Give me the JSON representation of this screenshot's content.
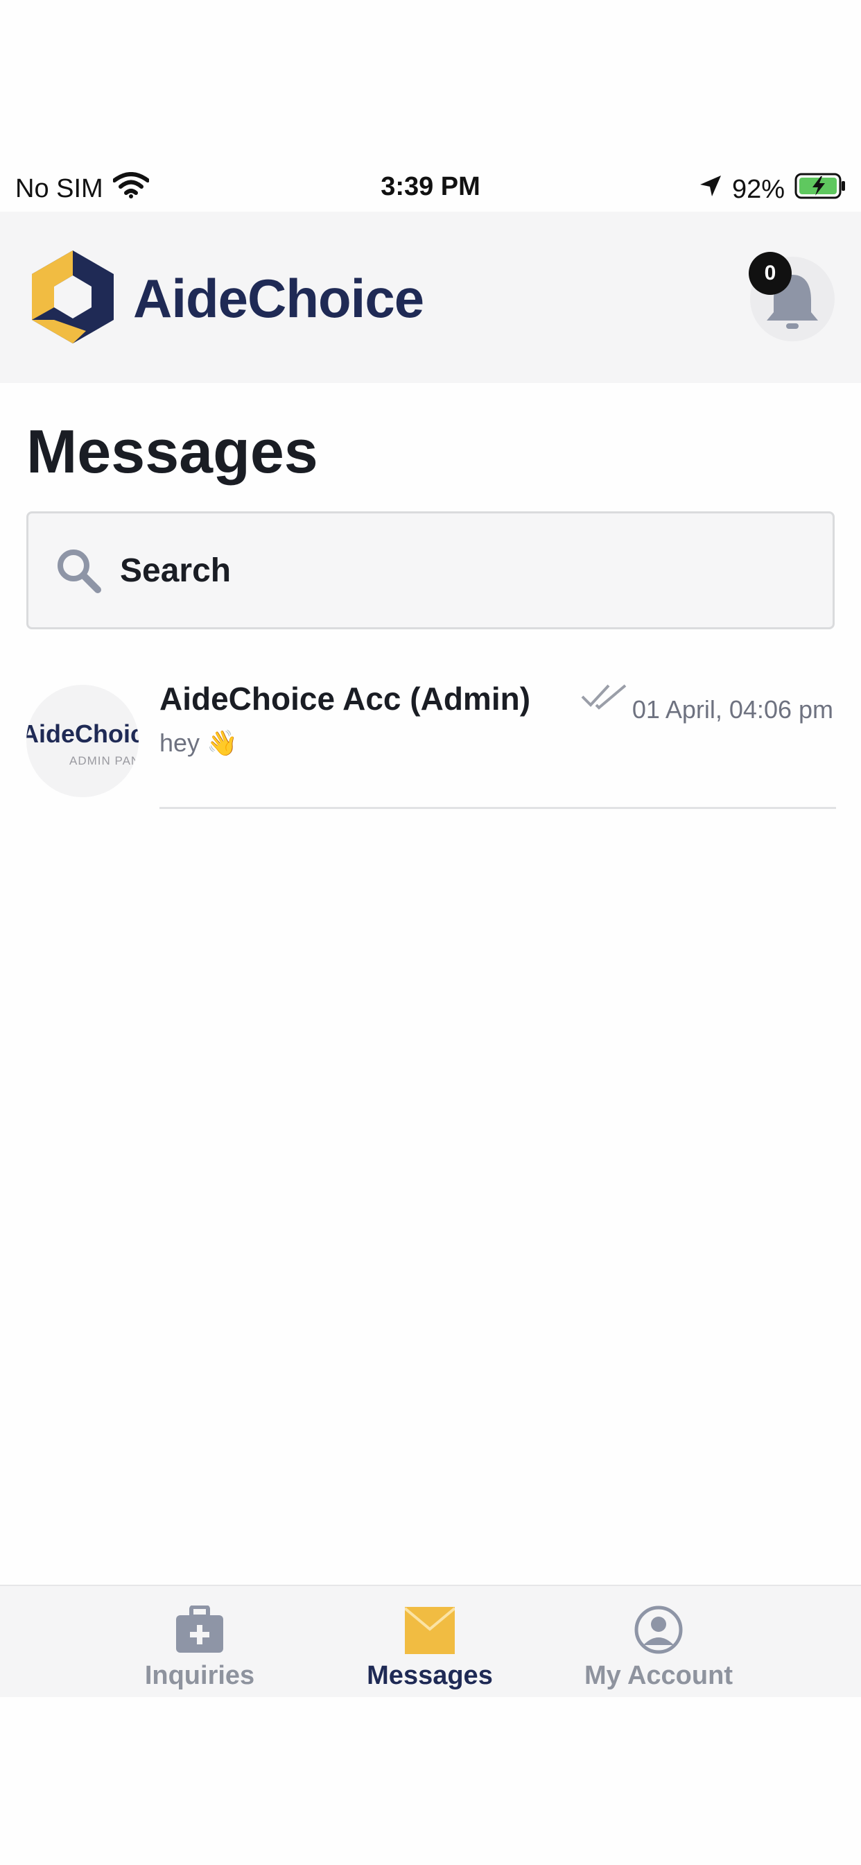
{
  "status_bar": {
    "carrier": "No SIM",
    "time": "3:39 PM",
    "battery": "92%"
  },
  "header": {
    "brand": "AideChoice",
    "notification_count": "0"
  },
  "page": {
    "title": "Messages"
  },
  "search": {
    "placeholder": "Search"
  },
  "conversations": [
    {
      "name": "AideChoice Acc (Admin)",
      "preview": "hey 👋",
      "time": "01 April, 04:06 pm",
      "avatar_main": "AideChoice",
      "avatar_sub": "ADMIN PANEL"
    }
  ],
  "tabs": [
    {
      "label": "Inquiries",
      "icon": "medical-briefcase-icon"
    },
    {
      "label": "Messages",
      "icon": "envelope-icon"
    },
    {
      "label": "My Account",
      "icon": "user-circle-icon"
    }
  ],
  "colors": {
    "brand_navy": "#1f2a55",
    "brand_yellow": "#f1bc42",
    "inactive_gray": "#8e939e",
    "battery_green": "#5fc85f"
  }
}
